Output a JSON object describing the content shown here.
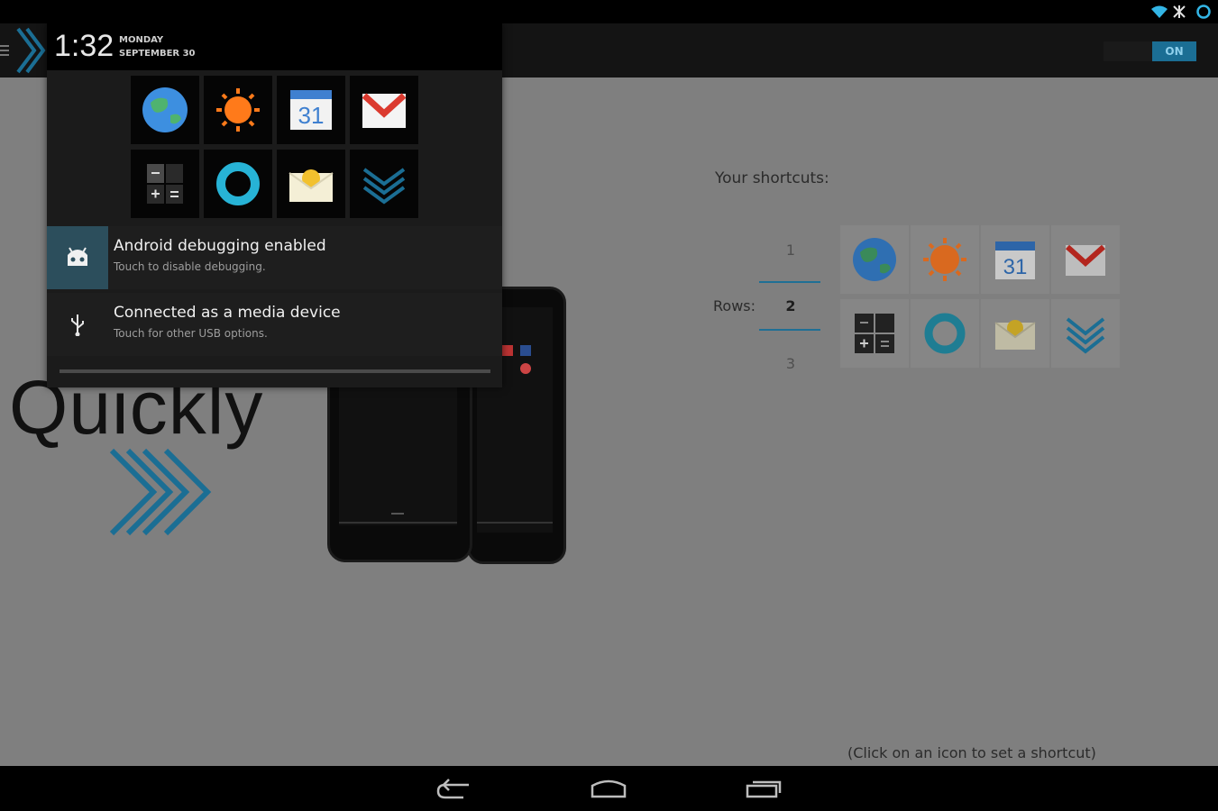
{
  "status_bar": {
    "icons": [
      "wifi-icon",
      "airplane-icon",
      "sync-icon"
    ]
  },
  "action_bar": {
    "toggle_label": "ON",
    "accent": "#1b6e94"
  },
  "notification_shade": {
    "time": "1:32",
    "day": "MONDAY",
    "date": "SEPTEMBER 30",
    "quick_icons": [
      "globe-icon",
      "sun-icon",
      "calendar-icon",
      "gmail-icon",
      "calculator-icon",
      "ring-icon",
      "email-icon",
      "chevron-icon"
    ],
    "calendar_day": "31",
    "notifications": [
      {
        "title": "Android debugging enabled",
        "subtitle": "Touch to disable debugging.",
        "icon": "android-debug-icon"
      },
      {
        "title": "Connected as a media device",
        "subtitle": "Touch for other USB options.",
        "icon": "usb-icon"
      }
    ]
  },
  "main": {
    "promo_text": "Quickly",
    "shortcuts_label": "Your shortcuts:",
    "rows_label": "Rows:",
    "row_options": [
      "1",
      "2",
      "3"
    ],
    "selected_row": "2",
    "shortcut_icons": [
      "globe-icon",
      "sun-icon",
      "calendar-icon",
      "gmail-icon",
      "calculator-icon",
      "ring-icon",
      "email-icon",
      "chevron-icon"
    ],
    "calendar_day": "31",
    "hint": "(Click on an icon to set a shortcut)"
  },
  "nav_bar": {
    "buttons": [
      "back-button",
      "home-button",
      "recents-button"
    ]
  }
}
